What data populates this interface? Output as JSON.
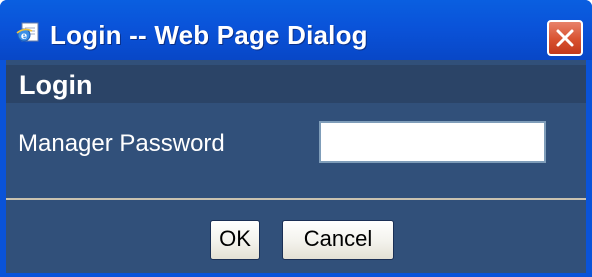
{
  "window": {
    "title": "Login -- Web Page Dialog",
    "app_icon": "ie-page-icon",
    "close_icon": "close-icon"
  },
  "dialog": {
    "heading": "Login",
    "password_label": "Manager Password",
    "password_value": "",
    "ok_label": "OK",
    "cancel_label": "Cancel"
  },
  "colors": {
    "titlebar": "#0a53d9",
    "panel_bg": "#31507a",
    "header_band": "#2b4467",
    "close_button": "#d8512f",
    "divider": "#c9c2b0"
  }
}
